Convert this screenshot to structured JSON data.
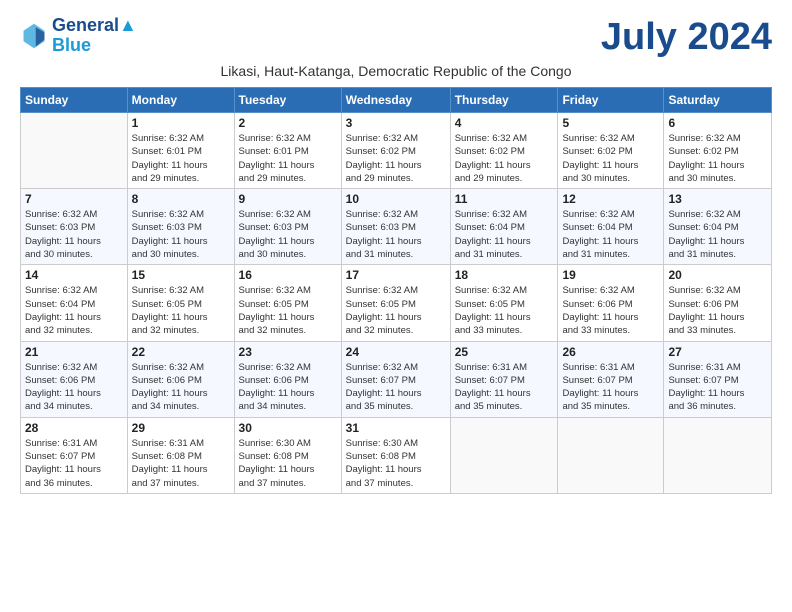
{
  "header": {
    "logo_line1": "General",
    "logo_line2": "Blue",
    "month_title": "July 2024",
    "subtitle": "Likasi, Haut-Katanga, Democratic Republic of the Congo"
  },
  "days_of_week": [
    "Sunday",
    "Monday",
    "Tuesday",
    "Wednesday",
    "Thursday",
    "Friday",
    "Saturday"
  ],
  "weeks": [
    [
      {
        "day": "",
        "sunrise": "",
        "sunset": "",
        "daylight": ""
      },
      {
        "day": "1",
        "sunrise": "Sunrise: 6:32 AM",
        "sunset": "Sunset: 6:01 PM",
        "daylight": "Daylight: 11 hours and 29 minutes."
      },
      {
        "day": "2",
        "sunrise": "Sunrise: 6:32 AM",
        "sunset": "Sunset: 6:01 PM",
        "daylight": "Daylight: 11 hours and 29 minutes."
      },
      {
        "day": "3",
        "sunrise": "Sunrise: 6:32 AM",
        "sunset": "Sunset: 6:02 PM",
        "daylight": "Daylight: 11 hours and 29 minutes."
      },
      {
        "day": "4",
        "sunrise": "Sunrise: 6:32 AM",
        "sunset": "Sunset: 6:02 PM",
        "daylight": "Daylight: 11 hours and 29 minutes."
      },
      {
        "day": "5",
        "sunrise": "Sunrise: 6:32 AM",
        "sunset": "Sunset: 6:02 PM",
        "daylight": "Daylight: 11 hours and 30 minutes."
      },
      {
        "day": "6",
        "sunrise": "Sunrise: 6:32 AM",
        "sunset": "Sunset: 6:02 PM",
        "daylight": "Daylight: 11 hours and 30 minutes."
      }
    ],
    [
      {
        "day": "7",
        "sunrise": "Sunrise: 6:32 AM",
        "sunset": "Sunset: 6:03 PM",
        "daylight": "Daylight: 11 hours and 30 minutes."
      },
      {
        "day": "8",
        "sunrise": "Sunrise: 6:32 AM",
        "sunset": "Sunset: 6:03 PM",
        "daylight": "Daylight: 11 hours and 30 minutes."
      },
      {
        "day": "9",
        "sunrise": "Sunrise: 6:32 AM",
        "sunset": "Sunset: 6:03 PM",
        "daylight": "Daylight: 11 hours and 30 minutes."
      },
      {
        "day": "10",
        "sunrise": "Sunrise: 6:32 AM",
        "sunset": "Sunset: 6:03 PM",
        "daylight": "Daylight: 11 hours and 31 minutes."
      },
      {
        "day": "11",
        "sunrise": "Sunrise: 6:32 AM",
        "sunset": "Sunset: 6:04 PM",
        "daylight": "Daylight: 11 hours and 31 minutes."
      },
      {
        "day": "12",
        "sunrise": "Sunrise: 6:32 AM",
        "sunset": "Sunset: 6:04 PM",
        "daylight": "Daylight: 11 hours and 31 minutes."
      },
      {
        "day": "13",
        "sunrise": "Sunrise: 6:32 AM",
        "sunset": "Sunset: 6:04 PM",
        "daylight": "Daylight: 11 hours and 31 minutes."
      }
    ],
    [
      {
        "day": "14",
        "sunrise": "Sunrise: 6:32 AM",
        "sunset": "Sunset: 6:04 PM",
        "daylight": "Daylight: 11 hours and 32 minutes."
      },
      {
        "day": "15",
        "sunrise": "Sunrise: 6:32 AM",
        "sunset": "Sunset: 6:05 PM",
        "daylight": "Daylight: 11 hours and 32 minutes."
      },
      {
        "day": "16",
        "sunrise": "Sunrise: 6:32 AM",
        "sunset": "Sunset: 6:05 PM",
        "daylight": "Daylight: 11 hours and 32 minutes."
      },
      {
        "day": "17",
        "sunrise": "Sunrise: 6:32 AM",
        "sunset": "Sunset: 6:05 PM",
        "daylight": "Daylight: 11 hours and 32 minutes."
      },
      {
        "day": "18",
        "sunrise": "Sunrise: 6:32 AM",
        "sunset": "Sunset: 6:05 PM",
        "daylight": "Daylight: 11 hours and 33 minutes."
      },
      {
        "day": "19",
        "sunrise": "Sunrise: 6:32 AM",
        "sunset": "Sunset: 6:06 PM",
        "daylight": "Daylight: 11 hours and 33 minutes."
      },
      {
        "day": "20",
        "sunrise": "Sunrise: 6:32 AM",
        "sunset": "Sunset: 6:06 PM",
        "daylight": "Daylight: 11 hours and 33 minutes."
      }
    ],
    [
      {
        "day": "21",
        "sunrise": "Sunrise: 6:32 AM",
        "sunset": "Sunset: 6:06 PM",
        "daylight": "Daylight: 11 hours and 34 minutes."
      },
      {
        "day": "22",
        "sunrise": "Sunrise: 6:32 AM",
        "sunset": "Sunset: 6:06 PM",
        "daylight": "Daylight: 11 hours and 34 minutes."
      },
      {
        "day": "23",
        "sunrise": "Sunrise: 6:32 AM",
        "sunset": "Sunset: 6:06 PM",
        "daylight": "Daylight: 11 hours and 34 minutes."
      },
      {
        "day": "24",
        "sunrise": "Sunrise: 6:32 AM",
        "sunset": "Sunset: 6:07 PM",
        "daylight": "Daylight: 11 hours and 35 minutes."
      },
      {
        "day": "25",
        "sunrise": "Sunrise: 6:31 AM",
        "sunset": "Sunset: 6:07 PM",
        "daylight": "Daylight: 11 hours and 35 minutes."
      },
      {
        "day": "26",
        "sunrise": "Sunrise: 6:31 AM",
        "sunset": "Sunset: 6:07 PM",
        "daylight": "Daylight: 11 hours and 35 minutes."
      },
      {
        "day": "27",
        "sunrise": "Sunrise: 6:31 AM",
        "sunset": "Sunset: 6:07 PM",
        "daylight": "Daylight: 11 hours and 36 minutes."
      }
    ],
    [
      {
        "day": "28",
        "sunrise": "Sunrise: 6:31 AM",
        "sunset": "Sunset: 6:07 PM",
        "daylight": "Daylight: 11 hours and 36 minutes."
      },
      {
        "day": "29",
        "sunrise": "Sunrise: 6:31 AM",
        "sunset": "Sunset: 6:08 PM",
        "daylight": "Daylight: 11 hours and 37 minutes."
      },
      {
        "day": "30",
        "sunrise": "Sunrise: 6:30 AM",
        "sunset": "Sunset: 6:08 PM",
        "daylight": "Daylight: 11 hours and 37 minutes."
      },
      {
        "day": "31",
        "sunrise": "Sunrise: 6:30 AM",
        "sunset": "Sunset: 6:08 PM",
        "daylight": "Daylight: 11 hours and 37 minutes."
      },
      {
        "day": "",
        "sunrise": "",
        "sunset": "",
        "daylight": ""
      },
      {
        "day": "",
        "sunrise": "",
        "sunset": "",
        "daylight": ""
      },
      {
        "day": "",
        "sunrise": "",
        "sunset": "",
        "daylight": ""
      }
    ]
  ]
}
